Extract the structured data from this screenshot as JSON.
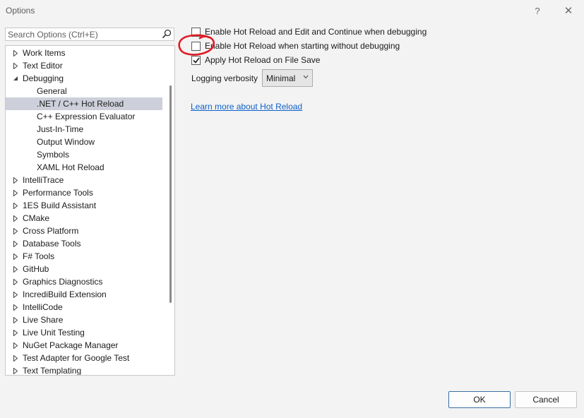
{
  "window": {
    "title": "Options",
    "help_label": "?",
    "close_label": "✕"
  },
  "search": {
    "placeholder": "Search Options (Ctrl+E)",
    "icon": "search-icon"
  },
  "tree": {
    "items": [
      {
        "label": "Work Items",
        "state": "collapsed",
        "level": 0
      },
      {
        "label": "Text Editor",
        "state": "collapsed",
        "level": 0
      },
      {
        "label": "Debugging",
        "state": "expanded",
        "level": 0
      },
      {
        "label": "General",
        "state": "leaf",
        "level": 1
      },
      {
        "label": ".NET / C++ Hot Reload",
        "state": "leaf",
        "level": 1,
        "selected": true
      },
      {
        "label": "C++ Expression Evaluator",
        "state": "leaf",
        "level": 1
      },
      {
        "label": "Just-In-Time",
        "state": "leaf",
        "level": 1
      },
      {
        "label": "Output Window",
        "state": "leaf",
        "level": 1
      },
      {
        "label": "Symbols",
        "state": "leaf",
        "level": 1
      },
      {
        "label": "XAML Hot Reload",
        "state": "leaf",
        "level": 1
      },
      {
        "label": "IntelliTrace",
        "state": "collapsed",
        "level": 0
      },
      {
        "label": "Performance Tools",
        "state": "collapsed",
        "level": 0
      },
      {
        "label": "1ES Build Assistant",
        "state": "collapsed",
        "level": 0
      },
      {
        "label": "CMake",
        "state": "collapsed",
        "level": 0
      },
      {
        "label": "Cross Platform",
        "state": "collapsed",
        "level": 0
      },
      {
        "label": "Database Tools",
        "state": "collapsed",
        "level": 0
      },
      {
        "label": "F# Tools",
        "state": "collapsed",
        "level": 0
      },
      {
        "label": "GitHub",
        "state": "collapsed",
        "level": 0
      },
      {
        "label": "Graphics Diagnostics",
        "state": "collapsed",
        "level": 0
      },
      {
        "label": "IncrediBuild Extension",
        "state": "collapsed",
        "level": 0
      },
      {
        "label": "IntelliCode",
        "state": "collapsed",
        "level": 0
      },
      {
        "label": "Live Share",
        "state": "collapsed",
        "level": 0
      },
      {
        "label": "Live Unit Testing",
        "state": "collapsed",
        "level": 0
      },
      {
        "label": "NuGet Package Manager",
        "state": "collapsed",
        "level": 0
      },
      {
        "label": "Test Adapter for Google Test",
        "state": "collapsed",
        "level": 0
      },
      {
        "label": "Text Templating",
        "state": "collapsed",
        "level": 0
      }
    ]
  },
  "options": {
    "items": [
      {
        "label": "Enable Hot Reload and Edit and Continue when debugging",
        "checked": false
      },
      {
        "label": "Enable Hot Reload when starting without debugging",
        "checked": false
      },
      {
        "label": "Apply Hot Reload on File Save",
        "checked": true
      }
    ],
    "verbosity_label": "Logging verbosity",
    "verbosity_value": "Minimal",
    "learn_more": "Learn more about Hot Reload"
  },
  "buttons": {
    "ok": "OK",
    "cancel": "Cancel"
  },
  "colors": {
    "selected_row": "#cdd0da",
    "link": "#0e60c9",
    "annotation": "#e01b24",
    "ok_border": "#3a6ea5"
  }
}
